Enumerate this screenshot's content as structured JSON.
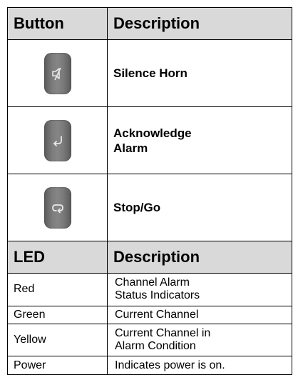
{
  "button_table": {
    "header": {
      "col1": "Button",
      "col2": "Description"
    },
    "rows": [
      {
        "icon": "silence-horn-icon",
        "description": "Silence Horn"
      },
      {
        "icon": "acknowledge-arrow-icon",
        "description": "Acknowledge\nAlarm"
      },
      {
        "icon": "stop-go-loop-icon",
        "description": "Stop/Go"
      }
    ]
  },
  "led_table": {
    "header": {
      "col1": "LED",
      "col2": "Description"
    },
    "rows": [
      {
        "led": "Red",
        "description": "Channel Alarm\nStatus Indicators"
      },
      {
        "led": "Green",
        "description": "Current Channel"
      },
      {
        "led": "Yellow",
        "description": "Current Channel in\nAlarm Condition"
      },
      {
        "led": "Power",
        "description": "Indicates power is on."
      }
    ]
  },
  "colors": {
    "header_background": "#d9d9d9",
    "button_face": "#7d7d7d",
    "border": "#000000"
  }
}
